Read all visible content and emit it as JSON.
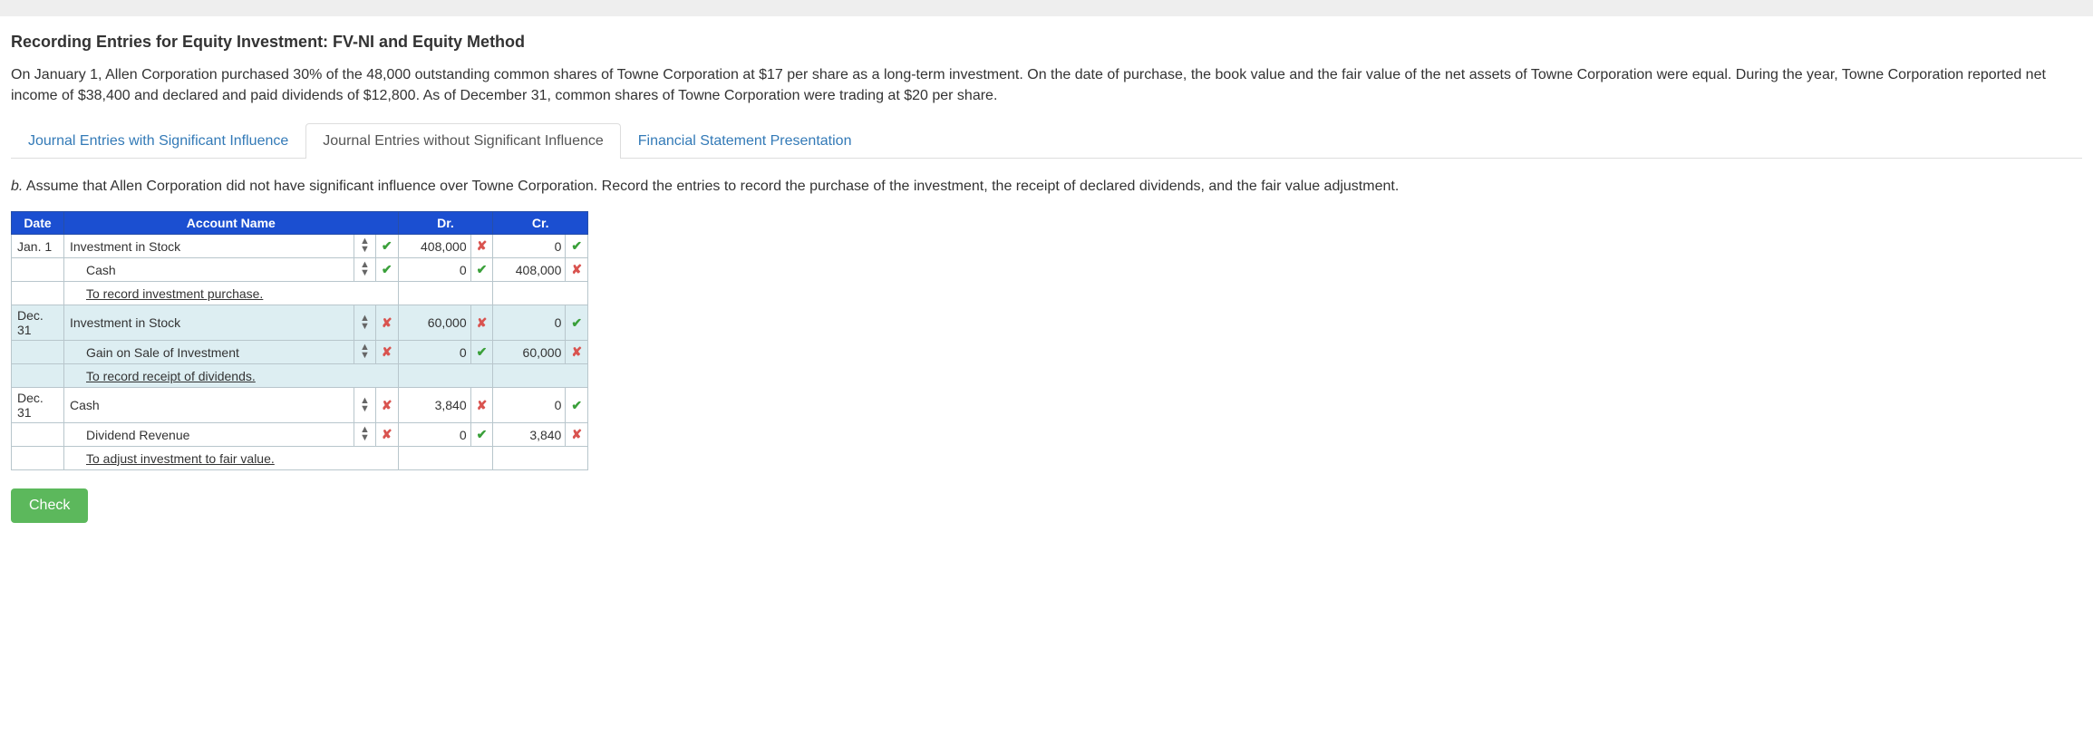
{
  "title": "Recording Entries for Equity Investment: FV-NI and Equity Method",
  "description": "On January 1, Allen Corporation purchased 30% of the 48,000 outstanding common shares of Towne Corporation at $17 per share as a long-term investment. On the date of purchase, the book value and the fair value of the net assets of Towne Corporation were equal. During the year, Towne Corporation reported net income of $38,400 and declared and paid dividends of $12,800. As of December 31, common shares of Towne Corporation were trading at $20 per share.",
  "tabs": [
    "Journal Entries with Significant Influence",
    "Journal Entries without Significant Influence",
    "Financial Statement Presentation"
  ],
  "instruction_prefix": "b.",
  "instruction": " Assume that Allen Corporation did not have significant influence over Towne Corporation. Record the entries to record the purchase of the investment, the receipt of declared dividends, and the fair value adjustment.",
  "headers": {
    "date": "Date",
    "account": "Account Name",
    "dr": "Dr.",
    "cr": "Cr."
  },
  "rows": [
    {
      "date": "Jan. 1",
      "acct": "Investment in Stock",
      "indent": false,
      "sort": true,
      "acct_ok": true,
      "dr": "408,000",
      "dr_ok": false,
      "cr": "0",
      "cr_ok": true,
      "shade": false
    },
    {
      "date": "",
      "acct": "Cash",
      "indent": true,
      "sort": true,
      "acct_ok": true,
      "dr": "0",
      "dr_ok": true,
      "cr": "408,000",
      "cr_ok": false,
      "shade": false
    },
    {
      "date": "",
      "acct": "To record investment purchase.",
      "memo": true,
      "shade": false
    },
    {
      "date": "Dec. 31",
      "acct": "Investment in Stock",
      "indent": false,
      "sort": true,
      "acct_ok": false,
      "dr": "60,000",
      "dr_ok": false,
      "cr": "0",
      "cr_ok": true,
      "shade": true
    },
    {
      "date": "",
      "acct": "Gain on Sale of Investment",
      "indent": true,
      "sort": true,
      "acct_ok": false,
      "dr": "0",
      "dr_ok": true,
      "cr": "60,000",
      "cr_ok": false,
      "shade": true
    },
    {
      "date": "",
      "acct": "To record receipt of dividends.",
      "memo": true,
      "shade": true
    },
    {
      "date": "Dec. 31",
      "acct": "Cash",
      "indent": false,
      "sort": true,
      "acct_ok": false,
      "dr": "3,840",
      "dr_ok": false,
      "cr": "0",
      "cr_ok": true,
      "shade": false
    },
    {
      "date": "",
      "acct": "Dividend Revenue",
      "indent": true,
      "sort": true,
      "acct_ok": false,
      "dr": "0",
      "dr_ok": true,
      "cr": "3,840",
      "cr_ok": false,
      "shade": false
    },
    {
      "date": "",
      "acct": "To adjust investment to fair value.",
      "memo": true,
      "shade": false
    }
  ],
  "check_label": "Check"
}
